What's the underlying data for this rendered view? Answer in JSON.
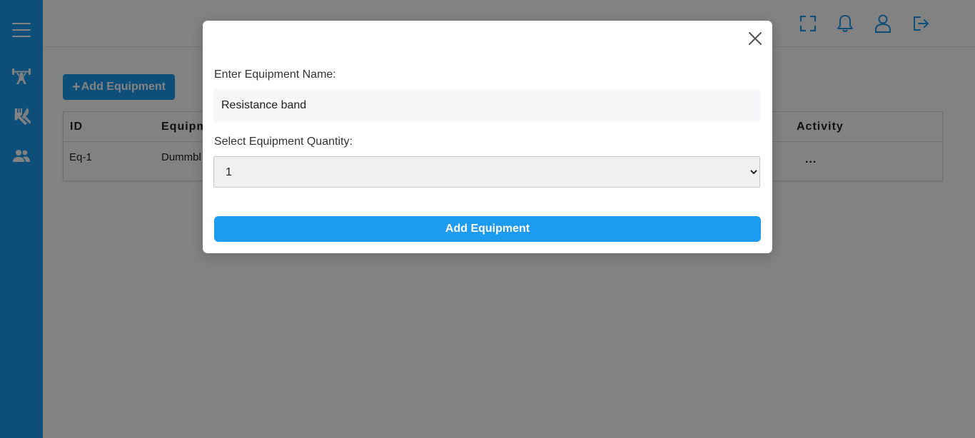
{
  "sidebar": {
    "icons": [
      "menu-icon",
      "weightlifter-icon",
      "fork-knife-icon",
      "users-icon"
    ]
  },
  "topbar": {
    "icons": [
      "fullscreen-icon",
      "bell-icon",
      "user-icon",
      "logout-icon"
    ]
  },
  "main": {
    "add_button_plus": "+",
    "add_button_label": "Add Equipment",
    "table": {
      "headers": {
        "id": "ID",
        "equipment": "Equipm",
        "activity": "Activity"
      },
      "rows": [
        {
          "id": "Eq-1",
          "equipment": "Dummbl",
          "activity": "..."
        }
      ]
    }
  },
  "modal": {
    "name_label": "Enter Equipment Name:",
    "name_value": "Resistance band",
    "quantity_label": "Select Equipment Quantity:",
    "quantity_selected": "1",
    "submit_label": "Add Equipment"
  },
  "colors": {
    "accent": "#1d9bf0",
    "overlay": "rgba(0,0,0,0.49)"
  }
}
